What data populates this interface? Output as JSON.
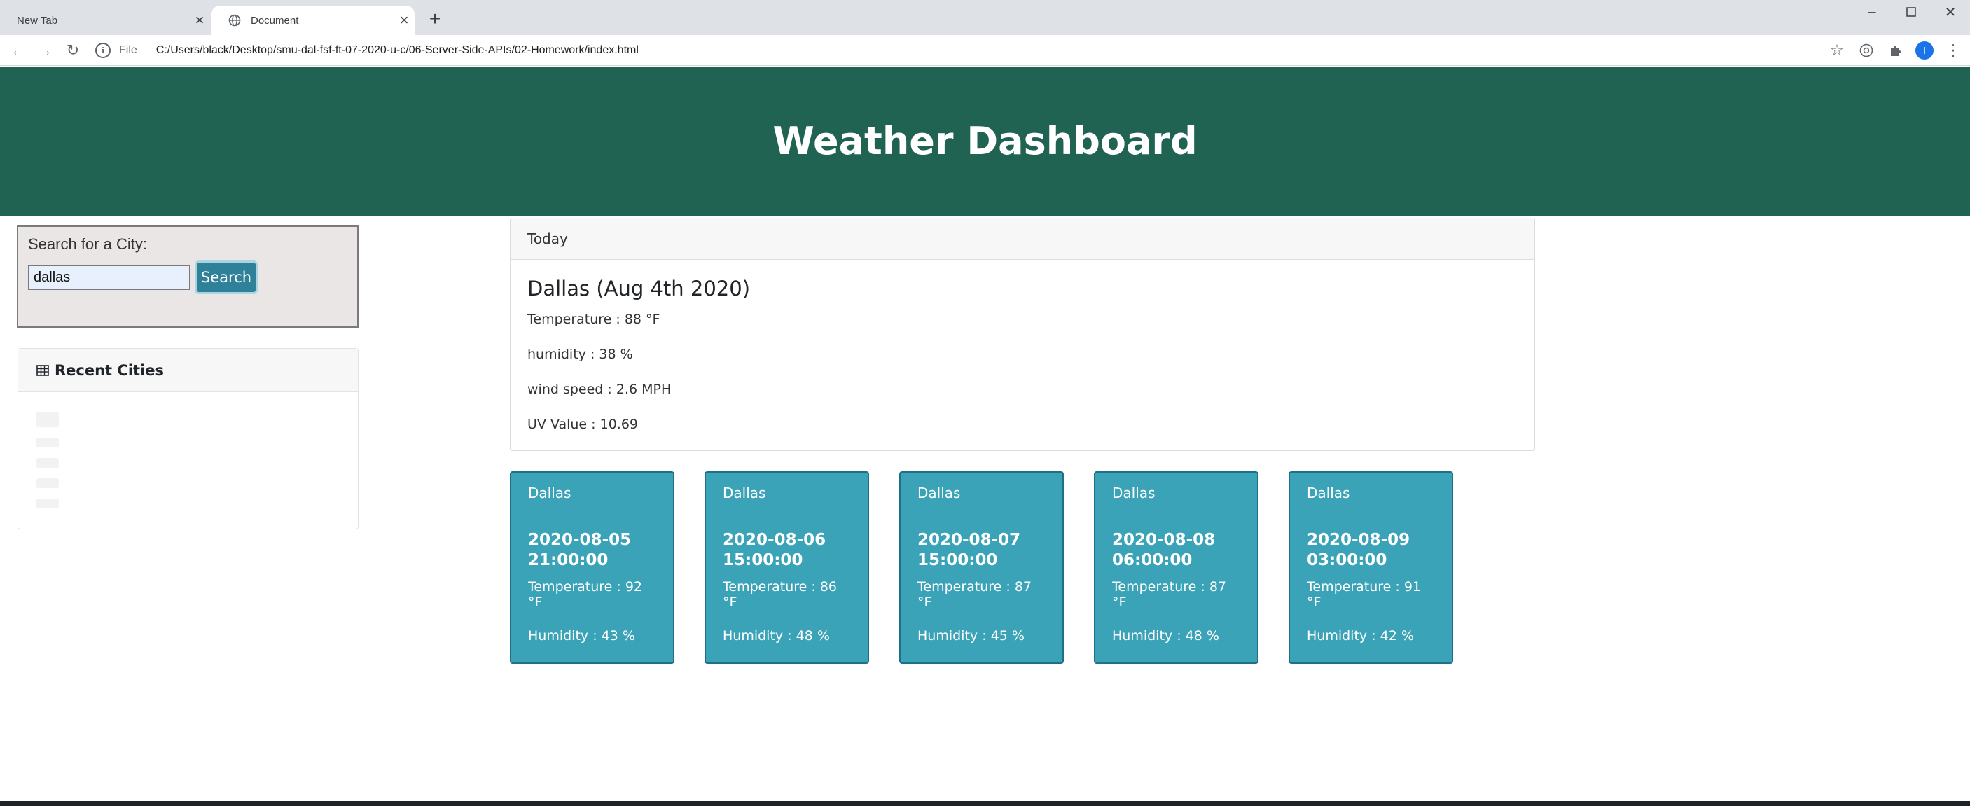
{
  "browser": {
    "tabs": [
      {
        "title": "New Tab",
        "active": false
      },
      {
        "title": "Document",
        "active": true
      }
    ],
    "address": {
      "scheme_label": "File",
      "url": "C:/Users/black/Desktop/smu-dal-fsf-ft-07-2020-u-c/06-Server-Side-APIs/02-Homework/index.html"
    },
    "profile_initial": "I"
  },
  "header": {
    "title": "Weather Dashboard"
  },
  "search": {
    "label": "Search for a City:",
    "input_value": "dallas",
    "button_label": "Search"
  },
  "recent": {
    "title": "Recent Cities",
    "items": [
      "",
      "",
      "",
      "",
      ""
    ]
  },
  "today": {
    "header": "Today",
    "city_line": "Dallas (Aug 4th 2020)",
    "temperature": "Temperature : 88 °F",
    "humidity": "humidity : 38 %",
    "wind": "wind speed : 2.6 MPH",
    "uv": "UV Value : 10.69"
  },
  "forecast": [
    {
      "city": "Dallas",
      "date": "2020-08-05",
      "time": "21:00:00",
      "temperature": "Temperature : 92 °F",
      "humidity": "Humidity : 43 %"
    },
    {
      "city": "Dallas",
      "date": "2020-08-06",
      "time": "15:00:00",
      "temperature": "Temperature : 86 °F",
      "humidity": "Humidity : 48 %"
    },
    {
      "city": "Dallas",
      "date": "2020-08-07",
      "time": "15:00:00",
      "temperature": "Temperature : 87 °F",
      "humidity": "Humidity : 45 %"
    },
    {
      "city": "Dallas",
      "date": "2020-08-08",
      "time": "06:00:00",
      "temperature": "Temperature : 87 °F",
      "humidity": "Humidity : 48 %"
    },
    {
      "city": "Dallas",
      "date": "2020-08-09",
      "time": "03:00:00",
      "temperature": "Temperature : 91 °F",
      "humidity": "Humidity : 42 %"
    }
  ],
  "colors": {
    "header_bg": "#216353",
    "forecast_bg": "#3aa3b8",
    "search_button": "#2e8198"
  }
}
